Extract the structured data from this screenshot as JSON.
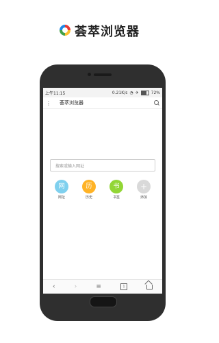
{
  "header": {
    "title": "荟萃浏览器"
  },
  "status_bar": {
    "time": "上午11:15",
    "speed": "0.21K/s",
    "battery": "72%"
  },
  "app_bar": {
    "title": "荟萃浏览器",
    "menu_icon": "⋮"
  },
  "search": {
    "placeholder": "搜索或输入网址"
  },
  "shortcuts": [
    {
      "char": "网",
      "label": "网址",
      "color": "#7fd0ee"
    },
    {
      "char": "历",
      "label": "历史",
      "color": "#ffb326"
    },
    {
      "char": "书",
      "label": "书签",
      "color": "#92d635"
    },
    {
      "char": "+",
      "label": "添加",
      "color": "#d9d9d9"
    }
  ],
  "bottom_nav": {
    "back": "‹",
    "forward": "›",
    "menu": "≡",
    "tabs": "1"
  }
}
